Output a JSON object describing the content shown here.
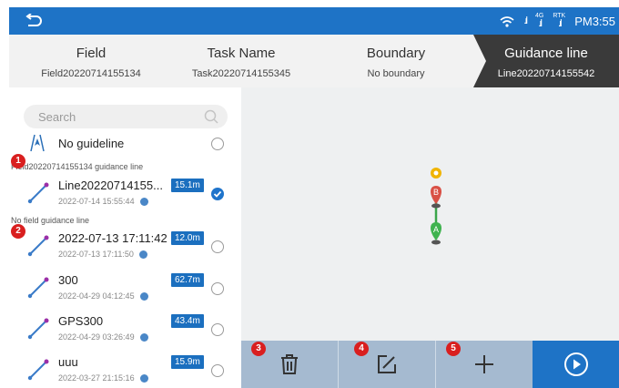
{
  "status_bar": {
    "signal_4g": "4G",
    "signal_rtk": "RTK",
    "time": "PM3:55"
  },
  "tabs": [
    {
      "title": "Field",
      "value": "Field20220714155134"
    },
    {
      "title": "Task Name",
      "value": "Task20220714155345"
    },
    {
      "title": "Boundary",
      "value": "No boundary"
    },
    {
      "title": "Guidance line",
      "value": "Line20220714155542"
    }
  ],
  "search": {
    "placeholder": "Search"
  },
  "no_guideline": {
    "label": "No guideline"
  },
  "groups": [
    {
      "label": "Field20220714155134 guidance line"
    },
    {
      "label": "No field guidance line"
    }
  ],
  "lines": [
    {
      "name": "Line20220714155...",
      "date": "2022-07-14 15:55:44",
      "length": "15.1m",
      "selected": true
    },
    {
      "name": "2022-07-13 17:11:42",
      "date": "2022-07-13 17:11:50",
      "length": "12.0m",
      "selected": false
    },
    {
      "name": "300",
      "date": "2022-04-29 04:12:45",
      "length": "62.7m",
      "selected": false
    },
    {
      "name": "GPS300",
      "date": "2022-04-29 03:26:49",
      "length": "43.4m",
      "selected": false
    },
    {
      "name": "uuu",
      "date": "2022-03-27 21:15:16",
      "length": "15.9m",
      "selected": false
    }
  ],
  "callouts": [
    "1",
    "2",
    "3",
    "4",
    "5"
  ],
  "map": {
    "point_a": "A",
    "point_b": "B"
  },
  "colors": {
    "accent": "#1e73c6",
    "badge": "#1b6fbf",
    "callout": "#d91f1f",
    "bottom_bar": "#a5bad0"
  }
}
